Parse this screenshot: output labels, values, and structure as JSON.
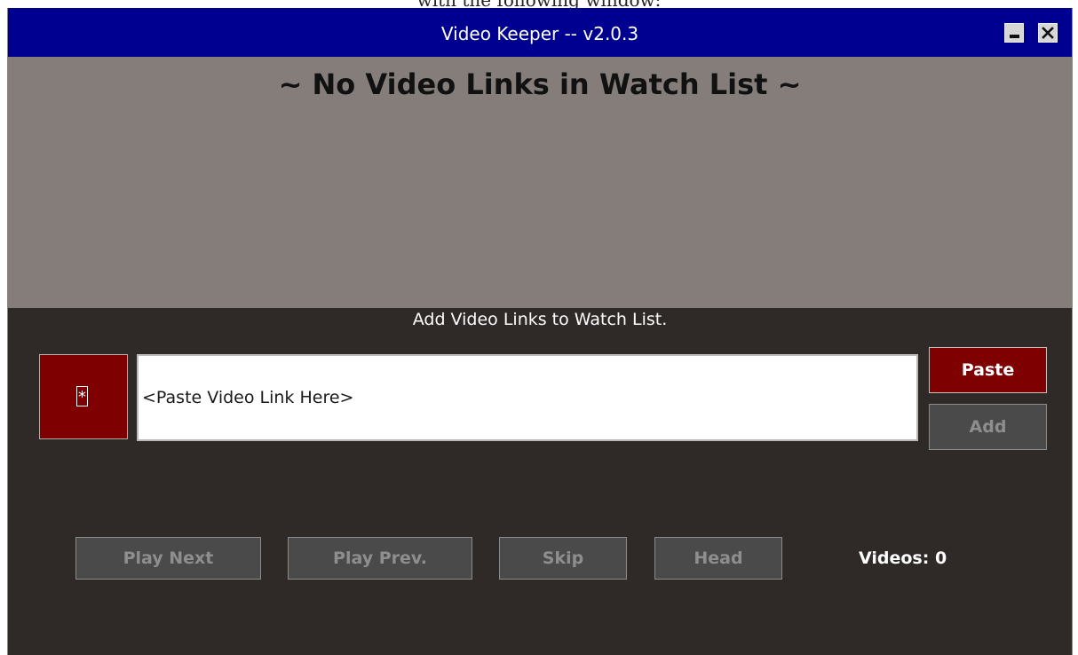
{
  "caption": "with the following window:",
  "window": {
    "title": "Video Keeper -- v2.0.3"
  },
  "watchlist": {
    "empty_message": "~ No Video Links in Watch List ~"
  },
  "add_section": {
    "instruction": "Add Video Links to Watch List.",
    "star_label": "*",
    "input_placeholder": "<Paste Video Link Here>",
    "input_value": "",
    "paste_label": "Paste",
    "add_label": "Add"
  },
  "controls": {
    "play_next_label": "Play Next",
    "play_prev_label": "Play Prev.",
    "skip_label": "Skip",
    "head_label": "Head",
    "video_count": "Videos: 0"
  },
  "colors": {
    "titlebar": "#000090",
    "top_panel": "#847d79",
    "body": "#2f2a27",
    "accent_red": "#7e0000",
    "disabled_button": "#4a4a4a"
  },
  "icons": {
    "minimize": "minimize-icon",
    "close": "close-icon"
  }
}
